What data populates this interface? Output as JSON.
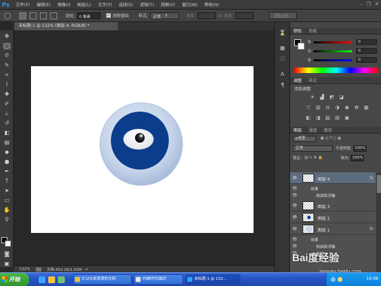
{
  "app": {
    "logo": "Ps"
  },
  "menu": [
    "文件(F)",
    "编辑(E)",
    "图像(I)",
    "图层(L)",
    "文字(Y)",
    "选择(S)",
    "滤镜(T)",
    "视图(V)",
    "窗口(W)",
    "帮助(H)"
  ],
  "window_controls": {
    "minimize": "–",
    "restore": "❐",
    "close": "✕"
  },
  "options": {
    "feather_label": "羽化:",
    "feather_value": "0 像素",
    "antialias_label": "消除锯齿",
    "antialias_checked": true,
    "style_label": "样式:",
    "style_value": "正常",
    "width_label": "宽度:",
    "height_label": "高度:",
    "refine_edge": "调整边缘..."
  },
  "document": {
    "tab_title": "未标题-1 @ 132% (图层 4, RGB/8) *"
  },
  "status": {
    "zoom": "132%",
    "doc_size": "文档:452.2K/1.91M"
  },
  "color_panel": {
    "tabs": [
      "颜色",
      "色板"
    ],
    "channels": [
      {
        "name": "R",
        "value": "0"
      },
      {
        "name": "G",
        "value": "0"
      },
      {
        "name": "B",
        "value": "0"
      }
    ]
  },
  "adjust_panel": {
    "tabs": [
      "调整",
      "样式"
    ],
    "add_label": "添加调整",
    "icons_row1": [
      "brightness-icon",
      "levels-icon",
      "curves-icon",
      "exposure-icon"
    ],
    "icons_row2": [
      "vibrance-icon",
      "hue-icon",
      "color-balance-icon",
      "bw-icon",
      "photo-filter-icon",
      "channel-mixer-icon",
      "color-lookup-icon"
    ],
    "icons_row3": [
      "invert-icon",
      "posterize-icon",
      "threshold-icon",
      "gradient-map-icon",
      "selective-color-icon"
    ]
  },
  "layers_panel": {
    "tabs": [
      "图层",
      "通道",
      "路径"
    ],
    "kind_label": "ρ类型",
    "blend_mode": "正常",
    "opacity_label": "不透明度:",
    "opacity": "100%",
    "lock_label": "锁定:",
    "fill_label": "填充:",
    "fill": "100%",
    "layers": [
      {
        "name": "图层 4",
        "selected": true,
        "fx": "fx",
        "effects_label": "效果",
        "effects": [
          "斜面和浮雕"
        ]
      },
      {
        "name": "图层 3",
        "selected": false
      },
      {
        "name": "图层 2",
        "selected": false
      },
      {
        "name": "图层 1",
        "selected": false,
        "fx": "fx",
        "effects_label": "效果",
        "effects": [
          "斜面和浮雕",
          "描边"
        ]
      }
    ]
  },
  "taskbar": {
    "start": "开始",
    "buttons": [
      {
        "label": "E:\\23\\未发表的文档",
        "icon_color": "#f0c040",
        "active": false
      },
      {
        "label": "PS制作扫描识",
        "icon_color": "#e8e8e8",
        "active": false
      },
      {
        "label": "未标题-1 @ 132...",
        "icon_color": "#2ea1ff",
        "active": true
      }
    ],
    "clock": "16:08"
  },
  "watermark": {
    "logo": "Bai度经验",
    "url": "jingyan.baidu.com"
  }
}
